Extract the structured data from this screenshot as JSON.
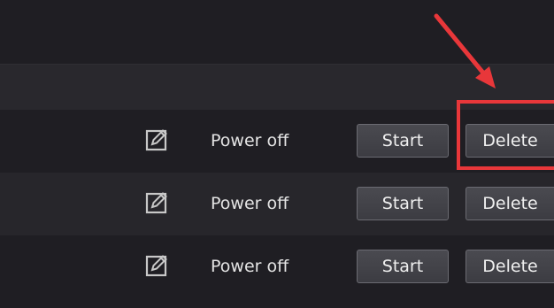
{
  "rows": [
    {
      "status": "Power off",
      "start_label": "Start",
      "delete_label": "Delete"
    },
    {
      "status": "Power off",
      "start_label": "Start",
      "delete_label": "Delete"
    },
    {
      "status": "Power off",
      "start_label": "Start",
      "delete_label": "Delete"
    }
  ],
  "colors": {
    "background": "#1e1d22",
    "annotation": "#e8373a",
    "button": "#3f3f45",
    "text": "#e4e4e4"
  },
  "icons": {
    "edit": "edit-icon",
    "annotation_arrow": "arrow-annotation"
  }
}
